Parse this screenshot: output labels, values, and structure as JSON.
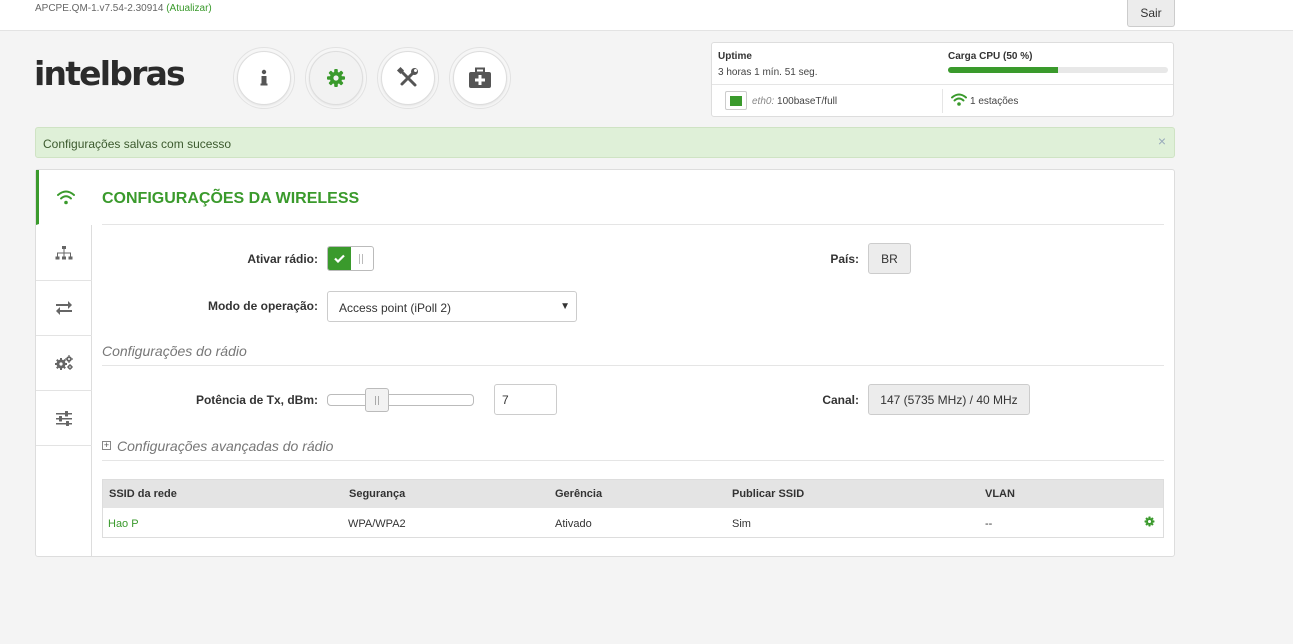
{
  "header": {
    "version": "APCPE.QM-1.v7.54-2.30914",
    "update_label": "(Atualizar)",
    "logout_label": "Sair",
    "logo_text": "intelbras"
  },
  "nav": [
    {
      "name": "info",
      "icon": "info-icon"
    },
    {
      "name": "settings",
      "icon": "gear-icon",
      "active": true
    },
    {
      "name": "tools",
      "icon": "tools-icon"
    },
    {
      "name": "support",
      "icon": "medical-kit-icon"
    }
  ],
  "status": {
    "uptime_label": "Uptime",
    "uptime_value": "3 horas 1 mín. 51 seg.",
    "cpu_label": "Carga CPU (50 %)",
    "cpu_percent": 50,
    "eth_name": "eth0:",
    "eth_value": "100baseT/full",
    "stations": "1 estações"
  },
  "alert": {
    "message": "Configurações salvas com sucesso",
    "close": "×"
  },
  "page": {
    "title": "CONFIGURAÇÕES DA WIRELESS",
    "enable_radio_label": "Ativar rádio:",
    "enable_radio_on": true,
    "country_label": "País:",
    "country_value": "BR",
    "mode_label": "Modo de operação:",
    "mode_value": "Access point (iPoll 2)",
    "radio_section": "Configurações do rádio",
    "tx_power_label": "Potência de Tx, dBm:",
    "tx_power_value": "7",
    "channel_label": "Canal:",
    "channel_value": "147 (5735 MHz) / 40 MHz",
    "advanced_section": "Configurações avançadas do rádio"
  },
  "table": {
    "headers": [
      "SSID da rede",
      "Segurança",
      "Gerência",
      "Publicar SSID",
      "VLAN"
    ],
    "rows": [
      {
        "ssid": "Hao P",
        "security": "WPA/WPA2",
        "management": "Ativado",
        "publish": "Sim",
        "vlan": "--"
      }
    ]
  },
  "colors": {
    "accent": "#3a9a2c",
    "alert_bg": "#dff0d8"
  }
}
